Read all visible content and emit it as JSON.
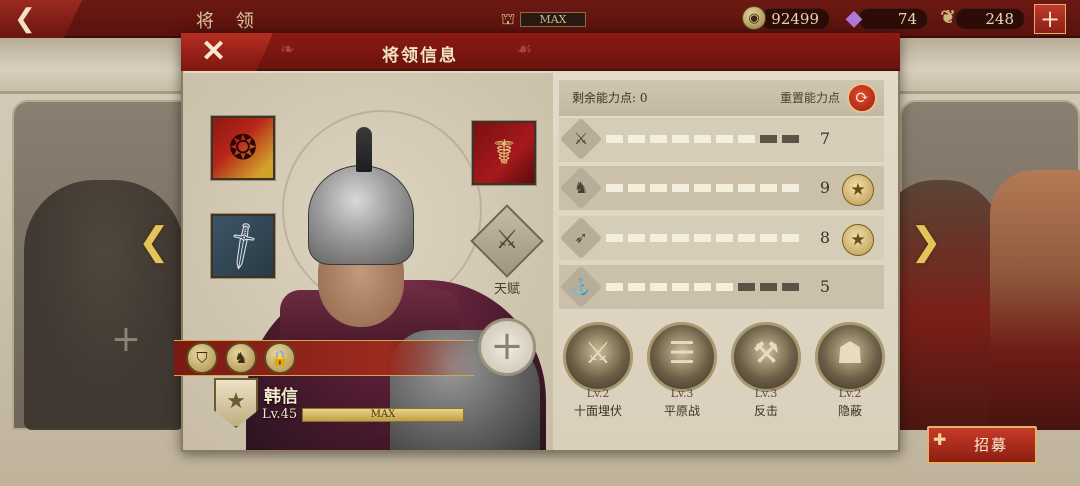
{
  "topbar": {
    "title": "将 领",
    "capacity_label": "MAX",
    "coins": "92499",
    "gems": "74",
    "food": "248",
    "icons": {
      "back": "back-arrow-icon",
      "bank": "bank-icon",
      "coin": "coin-icon",
      "gem": "gem-icon",
      "food": "food-icon",
      "plus": "plus-icon"
    }
  },
  "panel": {
    "title": "将领信息",
    "close_glyph": "✕"
  },
  "hero": {
    "name": "韩信",
    "level": "Lv.45",
    "xp_label": "MAX",
    "xp_fraction": 1.0,
    "talent_label": "天赋",
    "equipment": [
      {
        "slot": "banner",
        "icon": "war-banner-icon"
      },
      {
        "slot": "weapon",
        "icon": "dagger-icon"
      },
      {
        "slot": "treasure",
        "icon": "caduceus-icon"
      }
    ],
    "badges": [
      "shield-badge-icon",
      "horse-badge-icon",
      "lock-icon"
    ]
  },
  "stats": {
    "remaining_label": "剩余能力点: 0",
    "reset_label": "重置能力点",
    "rows": [
      {
        "icon": "sword-icon",
        "value": "7",
        "filled": 7,
        "total": 9,
        "starred": false
      },
      {
        "icon": "horse-icon",
        "value": "9",
        "filled": 9,
        "total": 9,
        "starred": true
      },
      {
        "icon": "bow-icon",
        "value": "8",
        "filled": 9,
        "total": 9,
        "starred": true
      },
      {
        "icon": "anchor-icon",
        "value": "5",
        "filled": 6,
        "total": 9,
        "starred": false
      }
    ]
  },
  "skills": [
    {
      "level": "Lv.2",
      "name": "十面埋伏",
      "icon": "ambush-icon"
    },
    {
      "level": "Lv.3",
      "name": "平原战",
      "icon": "plains-battle-icon"
    },
    {
      "level": "Lv.3",
      "name": "反击",
      "icon": "counterattack-icon"
    },
    {
      "level": "Lv.2",
      "name": "隐蔽",
      "icon": "conceal-icon"
    }
  ],
  "recruit": {
    "label": "招募"
  },
  "colors": {
    "topbar": "#6d1812",
    "accent_red": "#c73a28",
    "gold": "#e5c35b",
    "panel_bg": "#e4dccb"
  }
}
